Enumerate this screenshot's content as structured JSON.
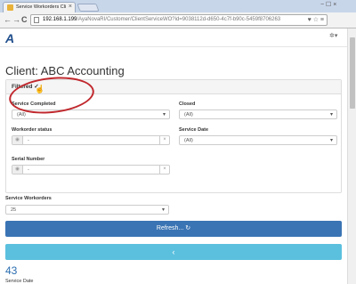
{
  "browser": {
    "tab_title": "Service Workorders Client",
    "tab_close": "×",
    "url_host": "192.168.1.199",
    "url_path": "/AyaNovaRI/Customer/ClientServiceWO?id=9038112d-d650-4c7f-b90c-5459f8706263",
    "nav_back": "←",
    "nav_forward": "→",
    "nav_reload": "C",
    "url_right_icons": "♥ ☆ ≡",
    "window_controls": "− ☐ ×"
  },
  "app": {
    "logo": "A",
    "settings_icon": "✲▾"
  },
  "client": {
    "title": "Client: ABC Accounting"
  },
  "filter_panel": {
    "heading": "Filtered ✓",
    "cursor": "☝",
    "service_completed": {
      "label": "Service Completed",
      "value": "(All)"
    },
    "closed": {
      "label": "Closed",
      "value": "(All)"
    },
    "workorder_status": {
      "label": "Workorder status",
      "value": "-"
    },
    "service_date": {
      "label": "Service Date",
      "value": "(All)"
    },
    "serial_number": {
      "label": "Serial Number",
      "value": "-"
    }
  },
  "service_workorders": {
    "label": "Service Workorders",
    "value": "25"
  },
  "buttons": {
    "refresh": "Refresh... ↻",
    "prev": "‹"
  },
  "results": {
    "count": "43",
    "partial_label": "Service Date"
  },
  "icons": {
    "eye": "◉",
    "clear": "×",
    "caret": "▾"
  },
  "colors": {
    "primary": "#3a74b4",
    "info": "#5bc0de",
    "highlight": "#c0282d",
    "count": "#2a6db0"
  }
}
